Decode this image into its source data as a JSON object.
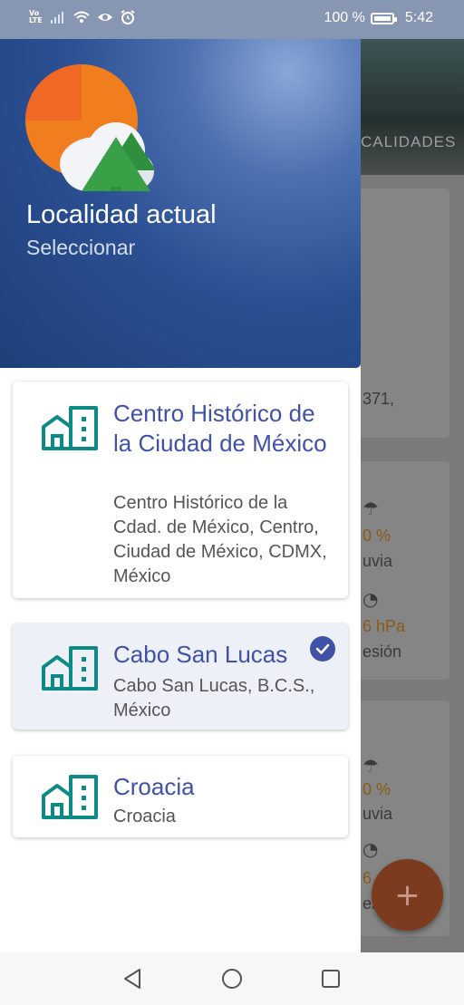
{
  "status_bar": {
    "volte_top": "Vo",
    "volte_bottom": "LTE",
    "battery_text": "100 %",
    "time": "5:42",
    "icons": [
      "signal-icon",
      "wifi-icon",
      "eye-icon",
      "alarm-icon",
      "battery-icon"
    ]
  },
  "background_app": {
    "tab_label": "CALIDADES",
    "card1_text": "371,",
    "card2": {
      "rain_value": "0 %",
      "rain_label": "uvia",
      "pressure_value": "6 hPa",
      "pressure_label": "esión"
    },
    "card3": {
      "rain_value": "0 %",
      "rain_label": "uvia",
      "pressure_value": "6",
      "pressure_label": "es"
    },
    "fab_symbol": "+"
  },
  "drawer": {
    "header": {
      "title": "Localidad actual",
      "subtitle": "Seleccionar"
    },
    "locations": [
      {
        "name": "Centro Histórico de la Ciudad de México",
        "address": "Centro Histórico de la Cdad. de México, Centro, Ciudad de México, CDMX, México",
        "selected": false
      },
      {
        "name": "Cabo San Lucas",
        "address": "Cabo San Lucas, B.C.S., México",
        "selected": true
      },
      {
        "name": "Croacia",
        "address": "Croacia",
        "selected": false
      }
    ]
  },
  "colors": {
    "accent": "#3f52a8",
    "building_icon": "#0e8a86",
    "fab": "#7c3a1f",
    "header_blue": "#2a4f92"
  },
  "nav_bar": {
    "icons": [
      "back-icon",
      "home-icon",
      "recents-icon"
    ]
  }
}
